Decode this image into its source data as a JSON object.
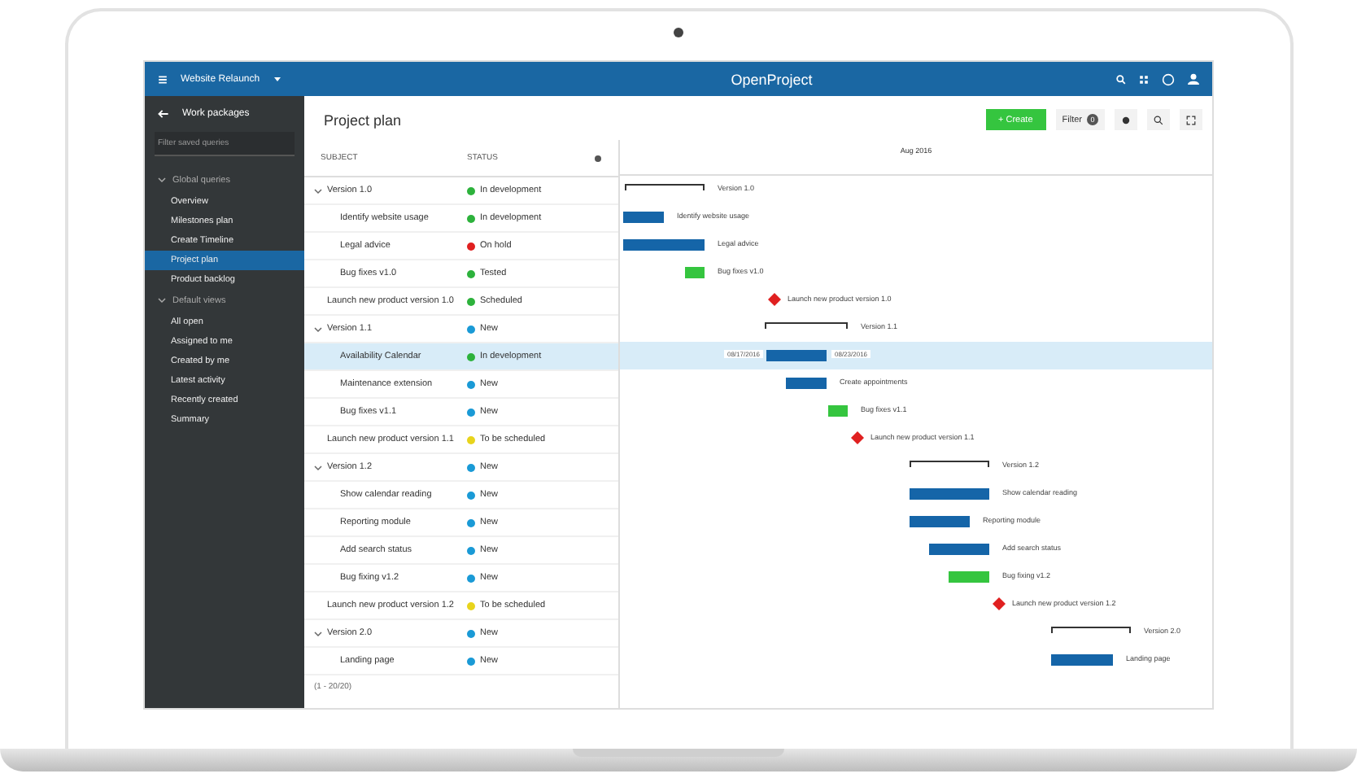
{
  "header": {
    "project": "Website Relaunch",
    "logo": "OpenProject"
  },
  "sidebar": {
    "back": "Work packages",
    "search": {
      "placeholder": "Filter saved queries"
    },
    "groups": [
      {
        "title": "Global queries",
        "expanded": true,
        "items": [
          {
            "label": "Overview",
            "selected": false
          },
          {
            "label": "Milestones plan",
            "selected": false
          },
          {
            "label": "Create Timeline",
            "selected": false
          },
          {
            "label": "Project plan",
            "selected": true
          },
          {
            "label": "Product backlog",
            "selected": false
          }
        ]
      },
      {
        "title": "Default views",
        "expanded": true,
        "items": [
          {
            "label": "All open",
            "selected": false
          },
          {
            "label": "Assigned to me",
            "selected": false
          },
          {
            "label": "Created by me",
            "selected": false
          },
          {
            "label": "Latest activity",
            "selected": false
          },
          {
            "label": "Recently created",
            "selected": false
          },
          {
            "label": "Summary",
            "selected": false
          }
        ]
      }
    ]
  },
  "title": "Project plan",
  "toolbar": {
    "create": "+ Create",
    "filter": "Filter",
    "filter_count": "0"
  },
  "table": {
    "columns": [
      "SUBJECT",
      "STATUS"
    ],
    "rows": [
      {
        "kind": "version",
        "subject": "Version 1.0",
        "expanded": true,
        "status": "In development",
        "color": "#2db23c",
        "selected": false,
        "label": "Version 1.0"
      },
      {
        "kind": "task",
        "subject": "Identify website usage",
        "status": "In development",
        "color": "#2db23c",
        "selected": false,
        "label": "Identify website usage"
      },
      {
        "kind": "task",
        "subject": "Legal advice",
        "status": "On hold",
        "color": "#e02020",
        "selected": false,
        "label": "Legal advice"
      },
      {
        "kind": "done",
        "subject": "Bug fixes v1.0",
        "status": "Tested",
        "color": "#2db23c",
        "selected": false,
        "label": "Bug fixes v1.0"
      },
      {
        "kind": "milestone",
        "subject": "Launch new product version 1.0",
        "status": "Scheduled",
        "color": "#2db23c",
        "selected": false,
        "label": "Launch new product version 1.0"
      },
      {
        "kind": "version",
        "subject": "Version 1.1",
        "expanded": true,
        "status": "New",
        "color": "#1a9ad6",
        "selected": false,
        "label": "Version 1.1"
      },
      {
        "kind": "task",
        "subject": "Availability Calendar",
        "status": "In development",
        "color": "#2db23c",
        "selected": true,
        "start": "08/17/2016",
        "end": "08/23/2016"
      },
      {
        "kind": "task",
        "subject": "Maintenance extension",
        "status": "New",
        "color": "#1a9ad6",
        "selected": false,
        "label": "Create appointments"
      },
      {
        "kind": "done",
        "subject": "Bug fixes v1.1",
        "status": "New",
        "color": "#1a9ad6",
        "selected": false,
        "label": "Bug fixes v1.1"
      },
      {
        "kind": "milestone",
        "subject": "Launch new product version 1.1",
        "status": "To be scheduled",
        "color": "#e8d41c",
        "selected": false,
        "label": "Launch new product version 1.1"
      },
      {
        "kind": "version",
        "subject": "Version 1.2",
        "expanded": true,
        "status": "New",
        "color": "#1a9ad6",
        "selected": false,
        "label": "Version 1.2"
      },
      {
        "kind": "task",
        "subject": "Show calendar reading",
        "status": "New",
        "color": "#1a9ad6",
        "selected": false,
        "label": "Show calendar reading"
      },
      {
        "kind": "task",
        "subject": "Reporting module",
        "status": "New",
        "color": "#1a9ad6",
        "selected": false,
        "label": "Reporting module"
      },
      {
        "kind": "task",
        "subject": "Add search status",
        "status": "New",
        "color": "#1a9ad6",
        "selected": false,
        "label": "Add search status"
      },
      {
        "kind": "done",
        "subject": "Bug fixing v1.2",
        "status": "New",
        "color": "#1a9ad6",
        "selected": false,
        "label": "Bug fixing v1.2"
      },
      {
        "kind": "milestone",
        "subject": "Launch new product version 1.2",
        "status": "To be scheduled",
        "color": "#e8d41c",
        "selected": false,
        "label": "Launch new product version 1.2"
      },
      {
        "kind": "version",
        "subject": "Version 2.0",
        "expanded": true,
        "status": "New",
        "color": "#1a9ad6",
        "selected": false,
        "label": "Version 2.0"
      },
      {
        "kind": "task",
        "subject": "Landing page",
        "status": "New",
        "color": "#1a9ad6",
        "selected": false,
        "label": "Landing page"
      }
    ],
    "footer": "(1 - 20/20)"
  },
  "gantt": {
    "month": "Aug 2016"
  }
}
